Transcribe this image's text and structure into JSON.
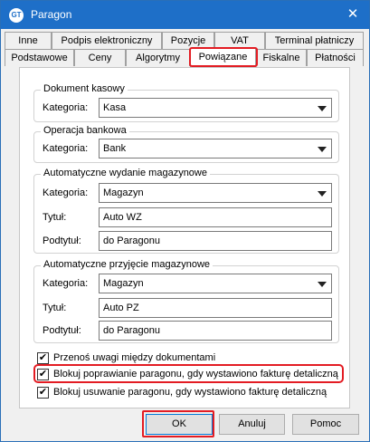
{
  "window": {
    "title": "Paragon",
    "icon": "app-logo-icon",
    "close_glyph": "✕",
    "icon_text": "GT"
  },
  "tabs": {
    "row1": [
      "Inne",
      "Podpis elektroniczny",
      "Pozycje",
      "VAT",
      "Terminal płatniczy"
    ],
    "row2": [
      "Podstawowe",
      "Ceny",
      "Algorytmy",
      "Powiązane",
      "Fiskalne",
      "Płatności"
    ],
    "active": "Powiązane"
  },
  "groups": {
    "cash_doc": {
      "legend": "Dokument kasowy",
      "category_label": "Kategoria:",
      "category_value": "Kasa"
    },
    "bank_op": {
      "legend": "Operacja bankowa",
      "category_label": "Kategoria:",
      "category_value": "Bank"
    },
    "auto_issue": {
      "legend": "Automatyczne wydanie magazynowe",
      "category_label": "Kategoria:",
      "category_value": "Magazyn",
      "title_label": "Tytuł:",
      "title_value": "Auto WZ",
      "subtitle_label": "Podtytuł:",
      "subtitle_value": "do Paragonu"
    },
    "auto_receipt": {
      "legend": "Automatyczne przyjęcie magazynowe",
      "category_label": "Kategoria:",
      "category_value": "Magazyn",
      "title_label": "Tytuł:",
      "title_value": "Auto PZ",
      "subtitle_label": "Podtytuł:",
      "subtitle_value": "do Paragonu"
    }
  },
  "checkboxes": [
    {
      "label": "Przenoś uwagi między dokumentami",
      "checked": true,
      "mark": "✔"
    },
    {
      "label": "Blokuj poprawianie paragonu, gdy wystawiono fakturę detaliczną",
      "checked": true,
      "mark": "✔"
    },
    {
      "label": "Blokuj usuwanie paragonu, gdy wystawiono fakturę detaliczną",
      "checked": true,
      "mark": "✔"
    }
  ],
  "buttons": {
    "ok": "OK",
    "cancel": "Anuluj",
    "help": "Pomoc"
  },
  "colors": {
    "titlebar": "#1e6fc8",
    "highlight": "#e31c23",
    "focus_border": "#0078d7"
  }
}
